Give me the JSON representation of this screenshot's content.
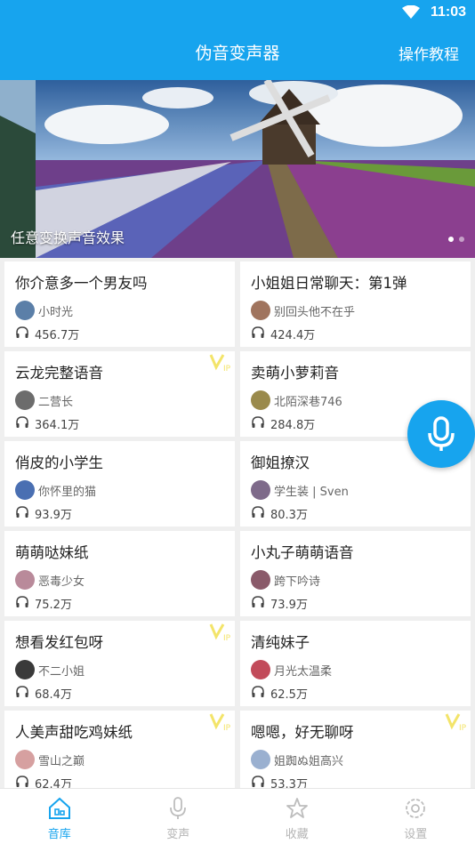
{
  "status_bar": {
    "time": "11:03"
  },
  "app_bar": {
    "title": "伪音变声器",
    "tutorial": "操作教程"
  },
  "banner": {
    "caption": "任意变换声音效果"
  },
  "cards": [
    {
      "name": "你介意多一个男友吗",
      "author": "小时光",
      "plays": "456.7万",
      "vip": false
    },
    {
      "name": "小姐姐日常聊天：第1弹",
      "author": "别回头他不在乎",
      "plays": "424.4万",
      "vip": false
    },
    {
      "name": "云龙完整语音",
      "author": "二营长",
      "plays": "364.1万",
      "vip": true
    },
    {
      "name": "卖萌小萝莉音",
      "author": "北陌深巷746",
      "plays": "284.8万",
      "vip": false
    },
    {
      "name": "俏皮的小学生",
      "author": "你怀里的猫",
      "plays": "93.9万",
      "vip": false
    },
    {
      "name": "御姐撩汉",
      "author": "学生装 | Sven",
      "plays": "80.3万",
      "vip": false
    },
    {
      "name": "萌萌哒妹纸",
      "author": "恶毒少女",
      "plays": "75.2万",
      "vip": false
    },
    {
      "name": "小丸子萌萌语音",
      "author": "跨下吟诗",
      "plays": "73.9万",
      "vip": false
    },
    {
      "name": "想看发红包呀",
      "author": "不二小姐",
      "plays": "68.4万",
      "vip": true
    },
    {
      "name": "清纯妹子",
      "author": "月光太温柔",
      "plays": "62.5万",
      "vip": false
    },
    {
      "name": "人美声甜吃鸡妹纸",
      "author": "雪山之巅",
      "plays": "62.4万",
      "vip": true
    },
    {
      "name": "嗯嗯，好无聊呀",
      "author": "姐踟ぬ姐高兴",
      "plays": "53.3万",
      "vip": true
    }
  ],
  "nav": [
    {
      "label": "音库",
      "icon": "library-icon",
      "active": true
    },
    {
      "label": "变声",
      "icon": "microphone-icon",
      "active": false
    },
    {
      "label": "收藏",
      "icon": "star-icon",
      "active": false
    },
    {
      "label": "设置",
      "icon": "gear-icon",
      "active": false
    }
  ],
  "colors": {
    "accent": "#17a4ee",
    "vip": "#f3e46a"
  }
}
